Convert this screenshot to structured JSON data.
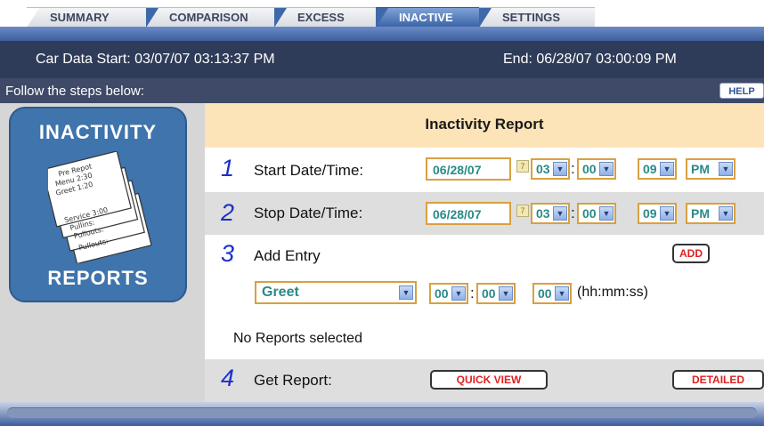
{
  "tabs": [
    {
      "label": "SUMMARY",
      "active": false
    },
    {
      "label": "COMPARISON",
      "active": false
    },
    {
      "label": "EXCESS",
      "active": false
    },
    {
      "label": "INACTIVE",
      "active": true
    },
    {
      "label": "SETTINGS",
      "active": false
    }
  ],
  "car_data": {
    "start_label": "Car Data Start:",
    "start_value": "03/07/07 03:13:37 PM",
    "end_label": "End:",
    "end_value": "06/28/07 03:00:09 PM"
  },
  "steps_text": "Follow the steps below:",
  "help_label": "HELP",
  "logo": {
    "top_text": "INACTIVITY",
    "bottom_text": "REPORTS",
    "paper_lines": [
      "Pre Repot",
      "Menu  2:30",
      "Greet  1:20",
      "Service 3:00",
      "Pullins:",
      "Pullouts:",
      "Pullouts:"
    ]
  },
  "report": {
    "title": "Inactivity Report",
    "step1": {
      "num": "1",
      "label": "Start Date/Time:",
      "date": "06/28/07",
      "hour": "03",
      "minute": "00",
      "second": "09",
      "ampm": "PM"
    },
    "step2": {
      "num": "2",
      "label": "Stop Date/Time:",
      "date": "06/28/07",
      "hour": "03",
      "minute": "00",
      "second": "09",
      "ampm": "PM"
    },
    "step3": {
      "num": "3",
      "label": "Add Entry",
      "add_label": "ADD",
      "entry_type": "Greet",
      "hh": "00",
      "mm": "00",
      "ss": "00",
      "hms_label": "(hh:mm:ss)",
      "no_reports": "No Reports selected"
    },
    "step4": {
      "num": "4",
      "label": "Get Report:",
      "quick_view_label": "QUICK VIEW",
      "detailed_label": "DETAILED"
    }
  },
  "colors": {
    "accent": "#3f68aa",
    "dark_bar": "#2f3c59",
    "header": "#fde4b8",
    "button_text": "#e02020",
    "step_number": "#1c2fc8"
  }
}
